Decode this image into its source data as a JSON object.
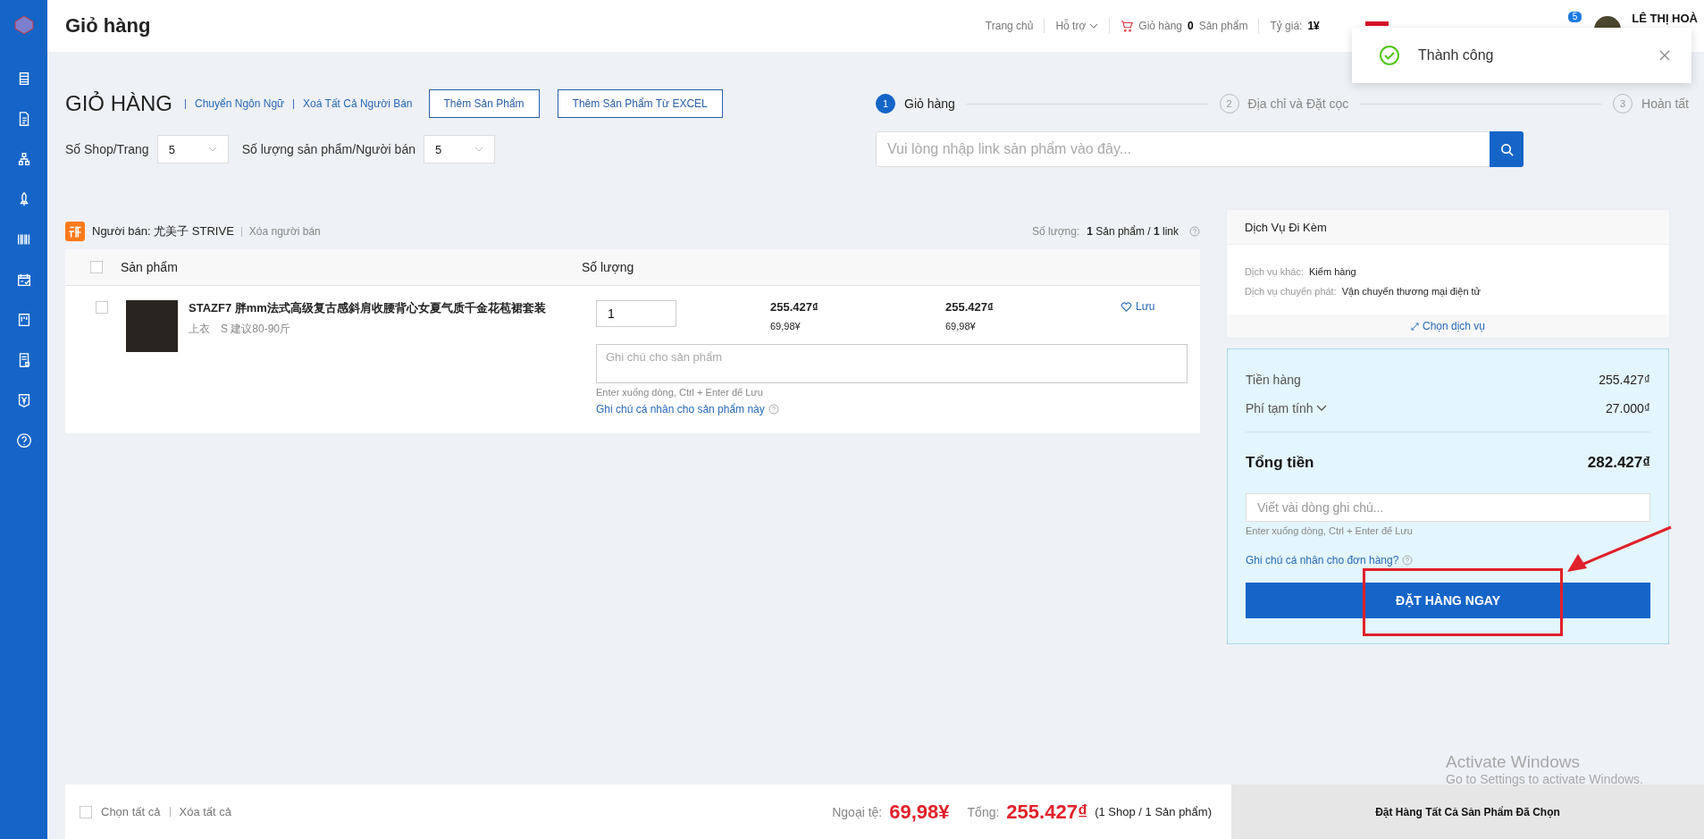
{
  "header": {
    "title": "Giỏ hàng",
    "home": "Trang chủ",
    "support": "Hỗ trợ",
    "cart": {
      "label": "Giỏ hàng",
      "count": "0",
      "unit": "Sản phẩm"
    },
    "rate": {
      "label": "Tỷ giá:",
      "value": "1¥"
    },
    "notification_count": "5",
    "user_name": "LÊ THỊ HOÀ"
  },
  "toast": {
    "message": "Thành công"
  },
  "page": {
    "heading": "GIỎ HÀNG",
    "links": [
      "Chuyển Ngôn Ngữ",
      "Xoá Tất Cả Người Bán"
    ],
    "buttons": [
      "Thêm Sản Phẩm",
      "Thêm Sản Phẩm Từ EXCEL"
    ]
  },
  "page_settings": [
    {
      "label": "Số Shop/Trang",
      "value": "5"
    },
    {
      "label": "Số lượng sản phẩm/Người bán",
      "value": "5"
    }
  ],
  "steps": [
    {
      "number": "1",
      "label": "Giỏ hàng",
      "selected": true
    },
    {
      "number": "2",
      "label": "Địa chỉ và Đặt cọc",
      "selected": false
    },
    {
      "number": "3",
      "label": "Hoàn tất",
      "selected": false
    }
  ],
  "search": {
    "placeholder": "Vui lòng nhập link sản phẩm vào đây..."
  },
  "seller": {
    "label": "Người bán: 尤美子 STRIVE",
    "remove": "Xóa người bán",
    "quantity_label": "Số lượng:",
    "quantity": "**1** Sản phẩm / **1** link"
  },
  "table": {
    "select_all": false,
    "columns": [
      "Sản phẩm",
      "Số lượng"
    ]
  },
  "items": [
    {
      "checked": false,
      "name": "STAZF7 胖mm法式高级复古感斜肩收腰背心女夏气质千金花苞裙套装",
      "attributes": [
        "上衣",
        "S 建议80-90斤"
      ],
      "quantity": "1",
      "unit_price": "255.427₫",
      "unit_price_cny": "69,98¥",
      "total": "255.427₫",
      "total_cny": "69,98¥",
      "save": "Lưu",
      "note_placeholder": "Ghi chú cho sản phẩm",
      "note_hint": "Enter xuống dòng, Ctrl + Enter để Lưu",
      "note_link": "Ghi chú cá nhân cho sản phẩm này"
    }
  ],
  "services": {
    "title": "Dịch Vụ Đi Kèm",
    "rows": [
      {
        "label": "Dịch vụ khác:",
        "value": "Kiểm hàng"
      },
      {
        "label": "Dịch vụ chuyển phát:",
        "value": "Vận chuyển thương mại điện tử"
      }
    ],
    "choose": "Chọn dịch vụ"
  },
  "summary": {
    "goods_label": "Tiền hàng",
    "goods": "255.427₫",
    "fee_label": "Phí tạm tính",
    "fee": "27.000₫",
    "total_label": "Tổng tiền",
    "total": "282.427₫",
    "note_placeholder": "Viết vài dòng ghi chú...",
    "note_hint": "Enter xuống dòng, Ctrl + Enter để Lưu",
    "note_link": "Ghi chú cá nhân cho đơn hàng?",
    "order_button": "ĐẶT HÀNG NGAY"
  },
  "footer": {
    "select_all": {
      "label": "Chọn tất cả",
      "checked": false
    },
    "clear": "Xóa tất cả",
    "foreign_label": "Ngoại tệ:",
    "foreign": "69,98¥",
    "total_label": "Tổng:",
    "total": "255.427₫",
    "count": "(1 Shop / 1 Sản phẩm)",
    "button": "Đặt Hàng Tất Cả Sản Phẩm Đã Chọn"
  },
  "os_notice": {
    "title": "Activate Windows",
    "subtitle": "Go to Settings to activate Windows."
  }
}
